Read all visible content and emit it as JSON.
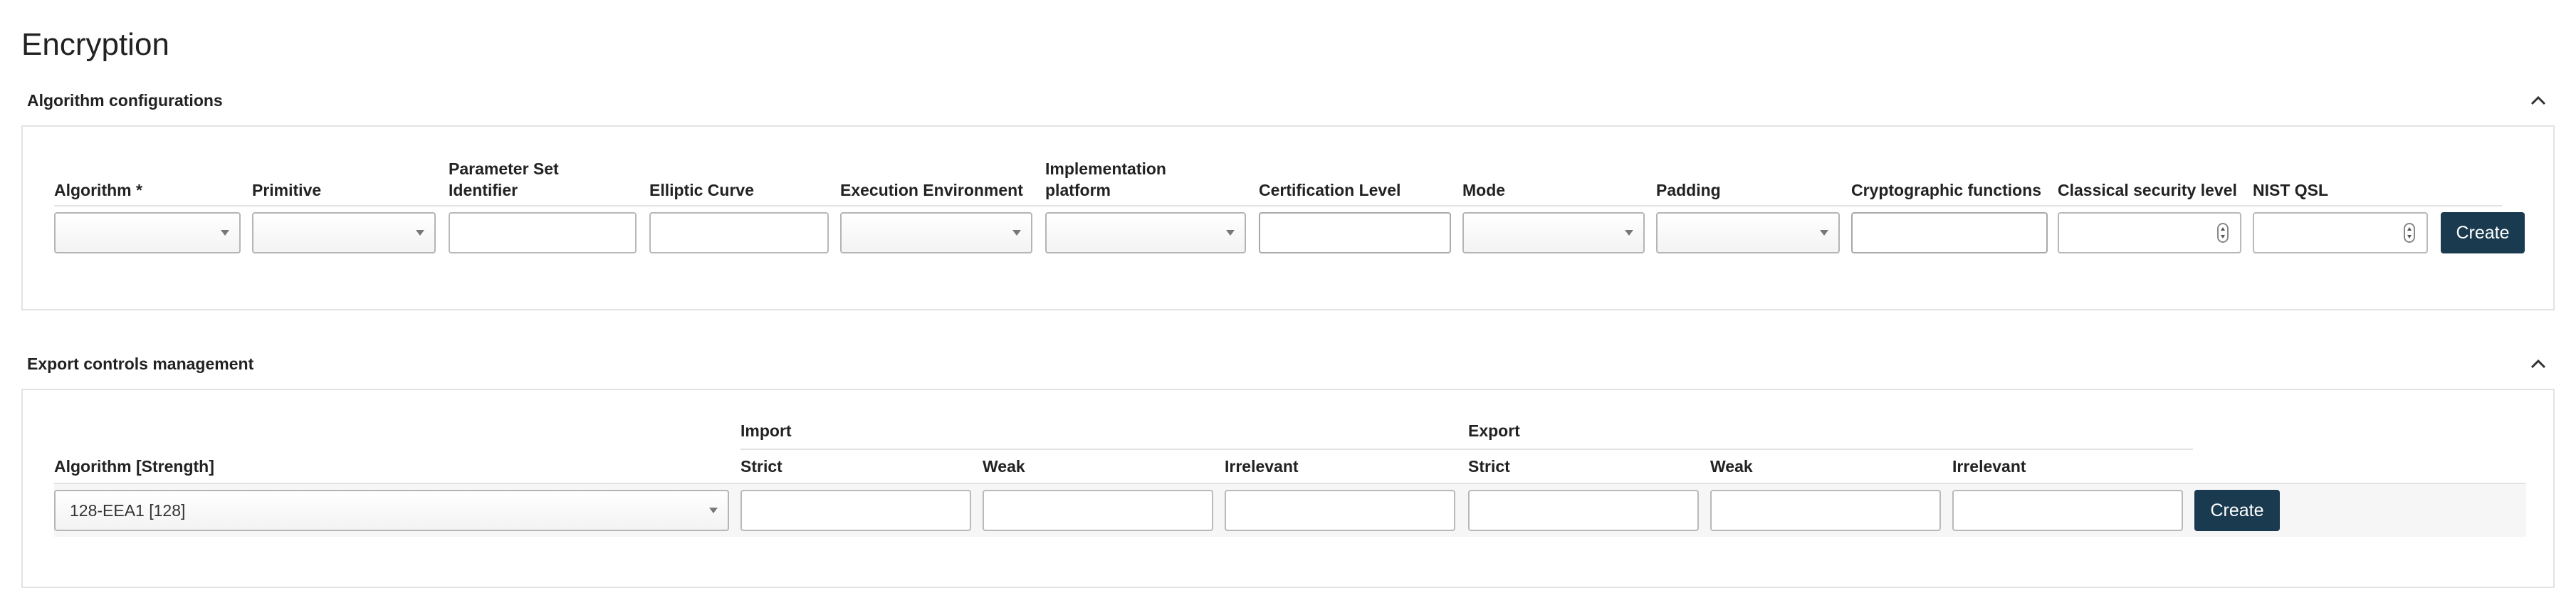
{
  "page": {
    "title": "Encryption"
  },
  "algorithm_configurations": {
    "header": "Algorithm configurations",
    "columns": {
      "algorithm": "Algorithm *",
      "primitive": "Primitive",
      "parameter_set_identifier_1": "Parameter Set",
      "parameter_set_identifier_2": "Identifier",
      "elliptic_curve": "Elliptic Curve",
      "execution_environment": "Execution Environment",
      "implementation_platform_1": "Implementation",
      "implementation_platform_2": "platform",
      "certification_level": "Certification Level",
      "mode": "Mode",
      "padding": "Padding",
      "cryptographic_functions": "Cryptographic functions",
      "classical_security_level": "Classical security level",
      "nist_qsl": "NIST QSL"
    },
    "values": {
      "algorithm": "",
      "primitive": "",
      "parameter_set_identifier": "",
      "elliptic_curve": "",
      "execution_environment": "",
      "implementation_platform": "",
      "certification_level": "",
      "mode": "",
      "padding": "",
      "cryptographic_functions": "",
      "classical_security_level": "",
      "nist_qsl": ""
    },
    "create_label": "Create"
  },
  "export_controls": {
    "header": "Export controls management",
    "group_import": "Import",
    "group_export": "Export",
    "columns": {
      "algorithm_strength": "Algorithm [Strength]",
      "import_strict": "Strict",
      "import_weak": "Weak",
      "import_irrelevant": "Irrelevant",
      "export_strict": "Strict",
      "export_weak": "Weak",
      "export_irrelevant": "Irrelevant"
    },
    "values": {
      "algorithm_strength": "128-EEA1 [128]",
      "import_strict": "",
      "import_weak": "",
      "import_irrelevant": "",
      "export_strict": "",
      "export_weak": "",
      "export_irrelevant": ""
    },
    "create_label": "Create"
  },
  "icons": {
    "collapse": "chevron-up-icon",
    "dropdown": "caret-down-icon",
    "spinner": "number-spinner-icon"
  },
  "colors": {
    "button_bg": "#1a3a4f",
    "button_text": "#ffffff",
    "panel_border": "#e3e3e3"
  }
}
